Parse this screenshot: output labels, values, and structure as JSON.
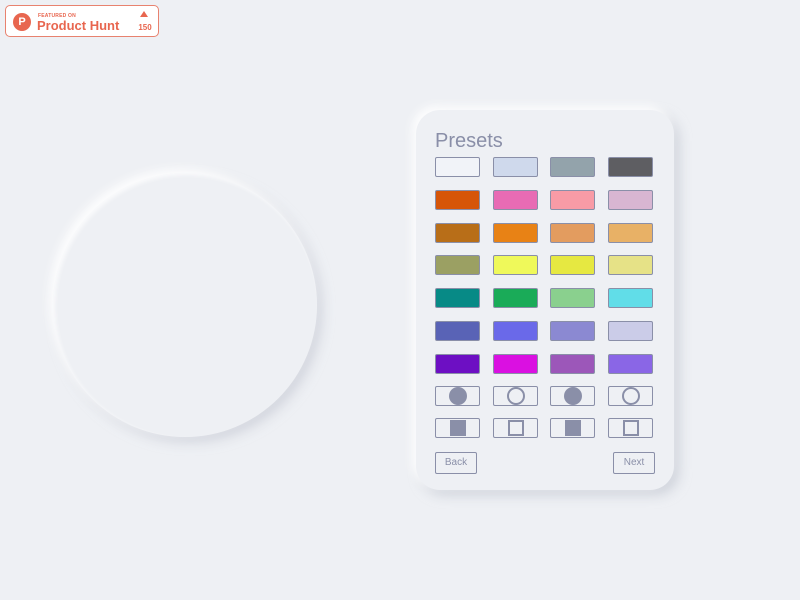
{
  "badge": {
    "featured_on": "FEATURED ON",
    "name": "Product Hunt",
    "logo_letter": "P",
    "upvote_count": "150",
    "color": "#e8664f"
  },
  "panel": {
    "title": "Presets",
    "swatches": [
      "#f1f3f8",
      "#cfd9ec",
      "#93a3ab",
      "#5e5e62",
      "#d65508",
      "#e86bb4",
      "#f89ba6",
      "#d8b6d2",
      "#b86e18",
      "#e88215",
      "#e39c5f",
      "#e8b166",
      "#9ba063",
      "#eff95a",
      "#e6e841",
      "#e6e287",
      "#078a86",
      "#1aab58",
      "#8ad08e",
      "#61dde8",
      "#5963b6",
      "#6a69e9",
      "#8b89d2",
      "#cbcce8",
      "#6d0fc3",
      "#da10e1",
      "#9c57b9",
      "#8a66e6"
    ],
    "shapes": [
      {
        "icon": "filled-circle-icon"
      },
      {
        "icon": "outline-circle-icon"
      },
      {
        "icon": "filled-circle-icon"
      },
      {
        "icon": "outline-circle-icon"
      },
      {
        "icon": "filled-square-icon"
      },
      {
        "icon": "outline-square-icon"
      },
      {
        "icon": "filled-square-icon"
      },
      {
        "icon": "outline-square-icon"
      }
    ],
    "back_label": "Back",
    "next_label": "Next"
  },
  "colors": {
    "background": "#eef0f4",
    "accent": "#8a8fa8"
  }
}
